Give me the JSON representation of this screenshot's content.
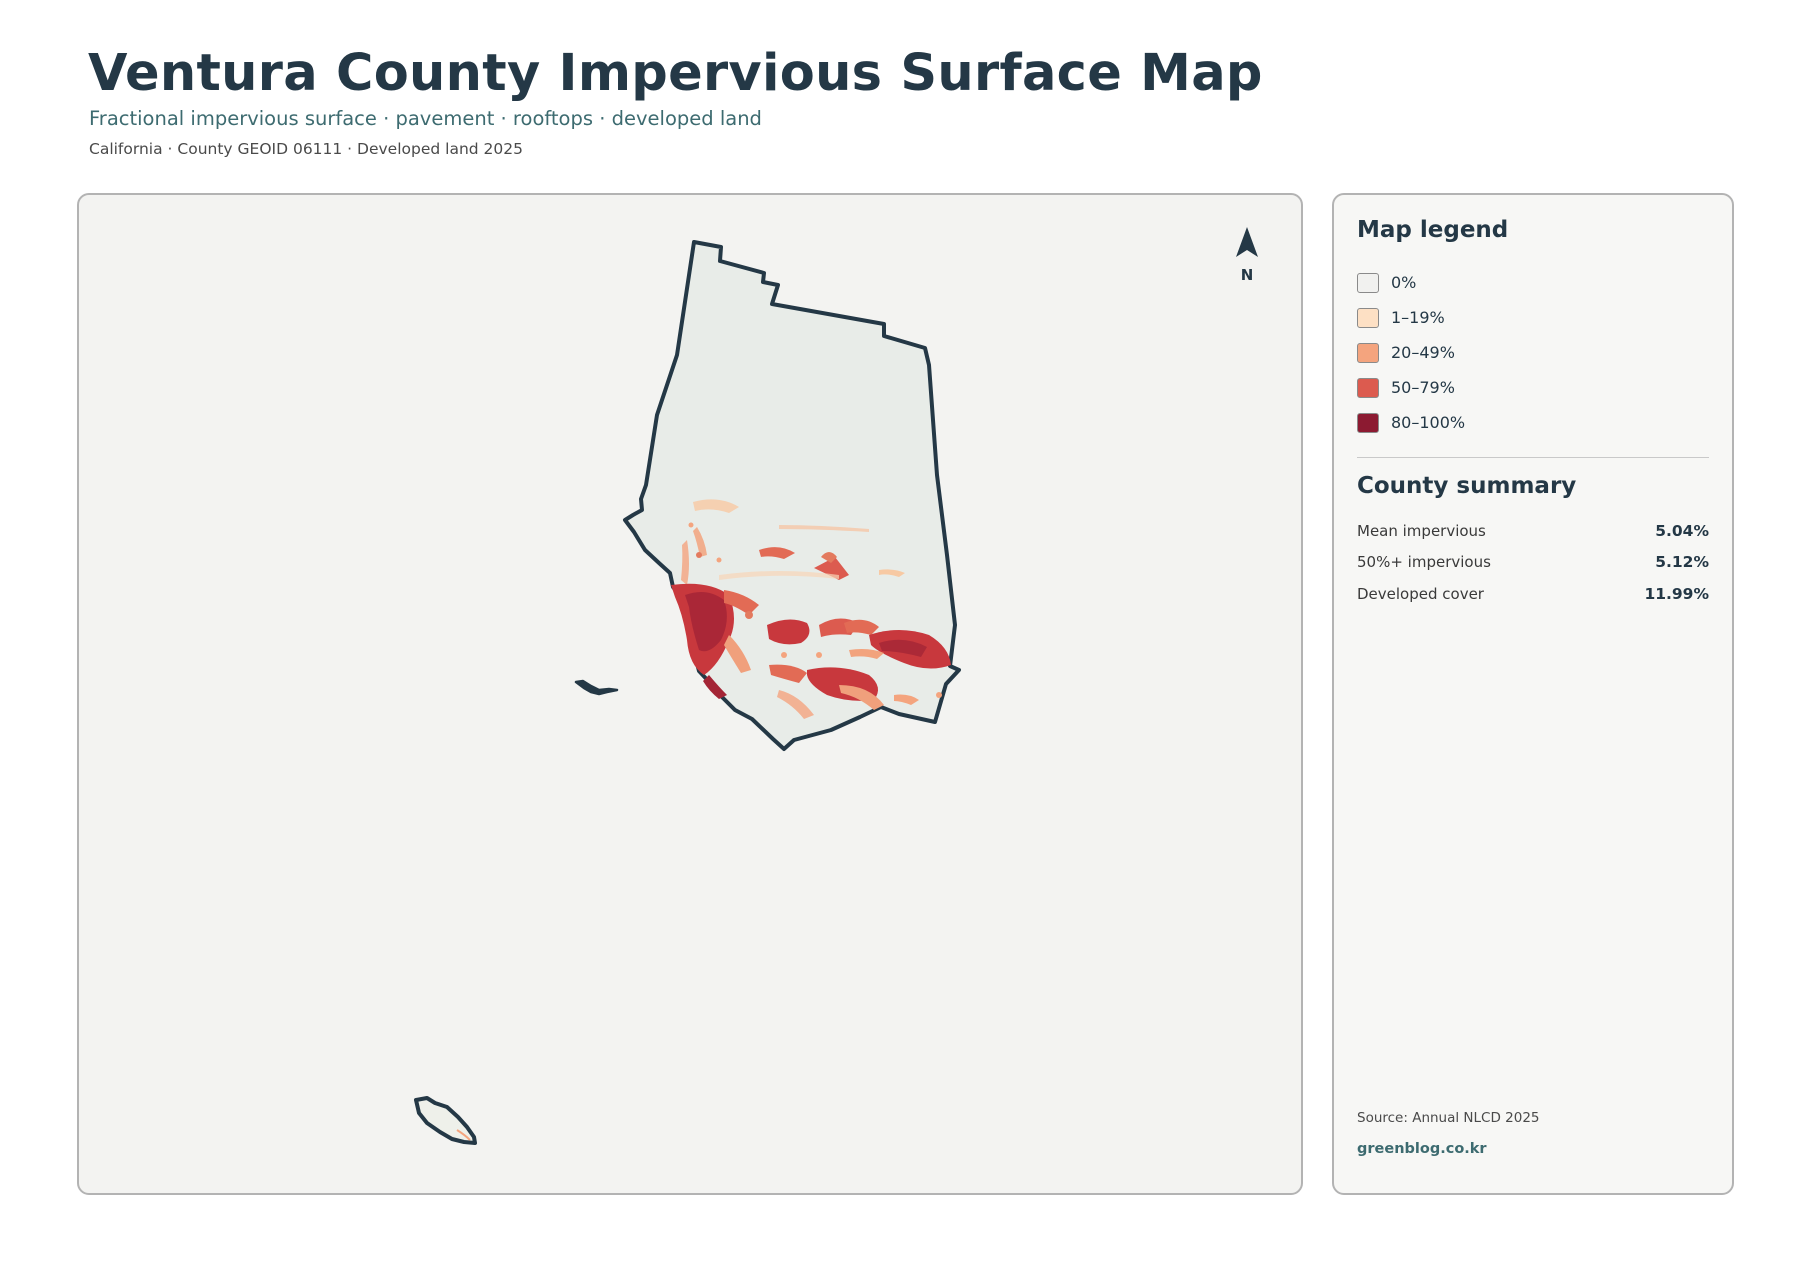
{
  "header": {
    "title": "Ventura County Impervious Surface Map",
    "subtitle": "Fractional impervious surface · pavement · rooftops · developed land",
    "meta": "California · County GEOID 06111 · Developed land 2025"
  },
  "map": {
    "north_label": "N",
    "background_color": "#f3f3f1",
    "land_color": "#e8ece8",
    "boundary_color": "#243846"
  },
  "legend": {
    "title": "Map legend",
    "items": [
      {
        "label": "0%",
        "color": "#f1f1ef"
      },
      {
        "label": "1–19%",
        "color": "#fde0c4"
      },
      {
        "label": "20–49%",
        "color": "#f4a47e"
      },
      {
        "label": "50–79%",
        "color": "#dc5b4f"
      },
      {
        "label": "80–100%",
        "color": "#8c1a31"
      }
    ]
  },
  "summary": {
    "title": "County summary",
    "rows": [
      {
        "label": "Mean impervious",
        "value": "5.04%"
      },
      {
        "label": "50%+ impervious",
        "value": "5.12%"
      },
      {
        "label": "Developed cover",
        "value": "11.99%"
      }
    ]
  },
  "footer": {
    "source": "Source: Annual NLCD 2025",
    "brand": "greenblog.co.kr"
  }
}
